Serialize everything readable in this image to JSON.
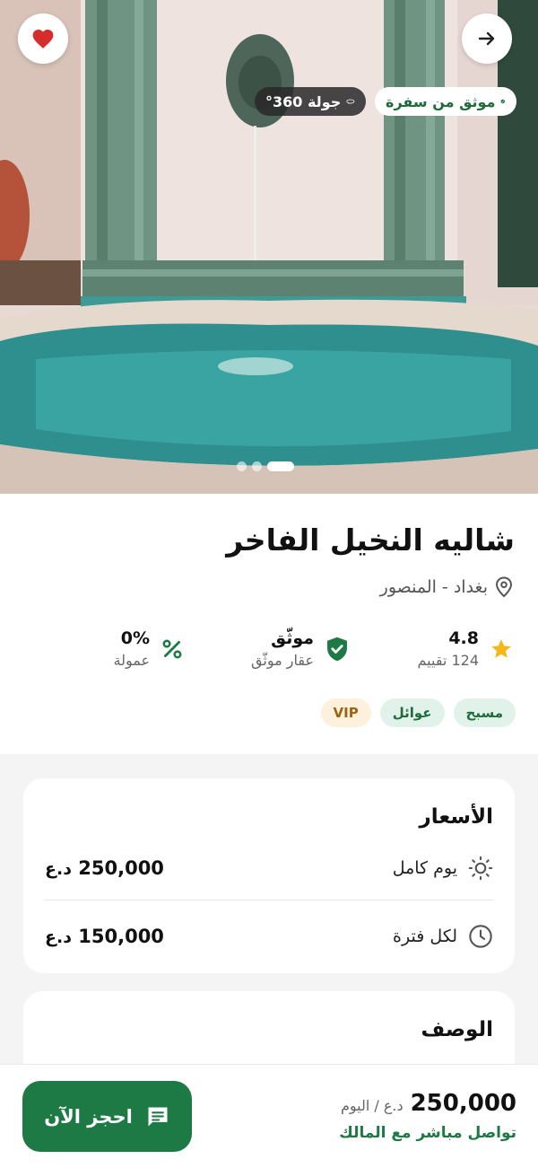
{
  "hero": {
    "verified_badge": "موثق من سفرة",
    "tour_badge": "جولة 360°",
    "image_count": 3,
    "active_image_index": 2
  },
  "listing": {
    "title": "شاليه النخيل الفاخر",
    "location": "بغداد - المنصور",
    "rating": {
      "value": "4.8",
      "label": "124 تقييم"
    },
    "verified": {
      "value": "موثّق",
      "label": "عقار موثّق"
    },
    "commission": {
      "value": "0%",
      "label": "عمولة"
    },
    "tags": [
      "مسبح",
      "عوائل",
      "VIP"
    ]
  },
  "prices": {
    "title": "الأسعار",
    "rows": [
      {
        "label": "يوم كامل",
        "amount": "250,000",
        "currency": "د.ع",
        "icon": "sun-icon"
      },
      {
        "label": "لكل فترة",
        "amount": "150,000",
        "currency": "د.ع",
        "icon": "clock-icon"
      }
    ]
  },
  "description": {
    "title": "الوصف"
  },
  "bottom_bar": {
    "price": "250,000",
    "per": "د.ع / اليوم",
    "contact": "تواصل مباشر مع المالك",
    "book_label": "احجز الآن"
  },
  "colors": {
    "brand_green": "#1d7a45",
    "star": "#f5b818",
    "heart": "#d62c2c"
  }
}
